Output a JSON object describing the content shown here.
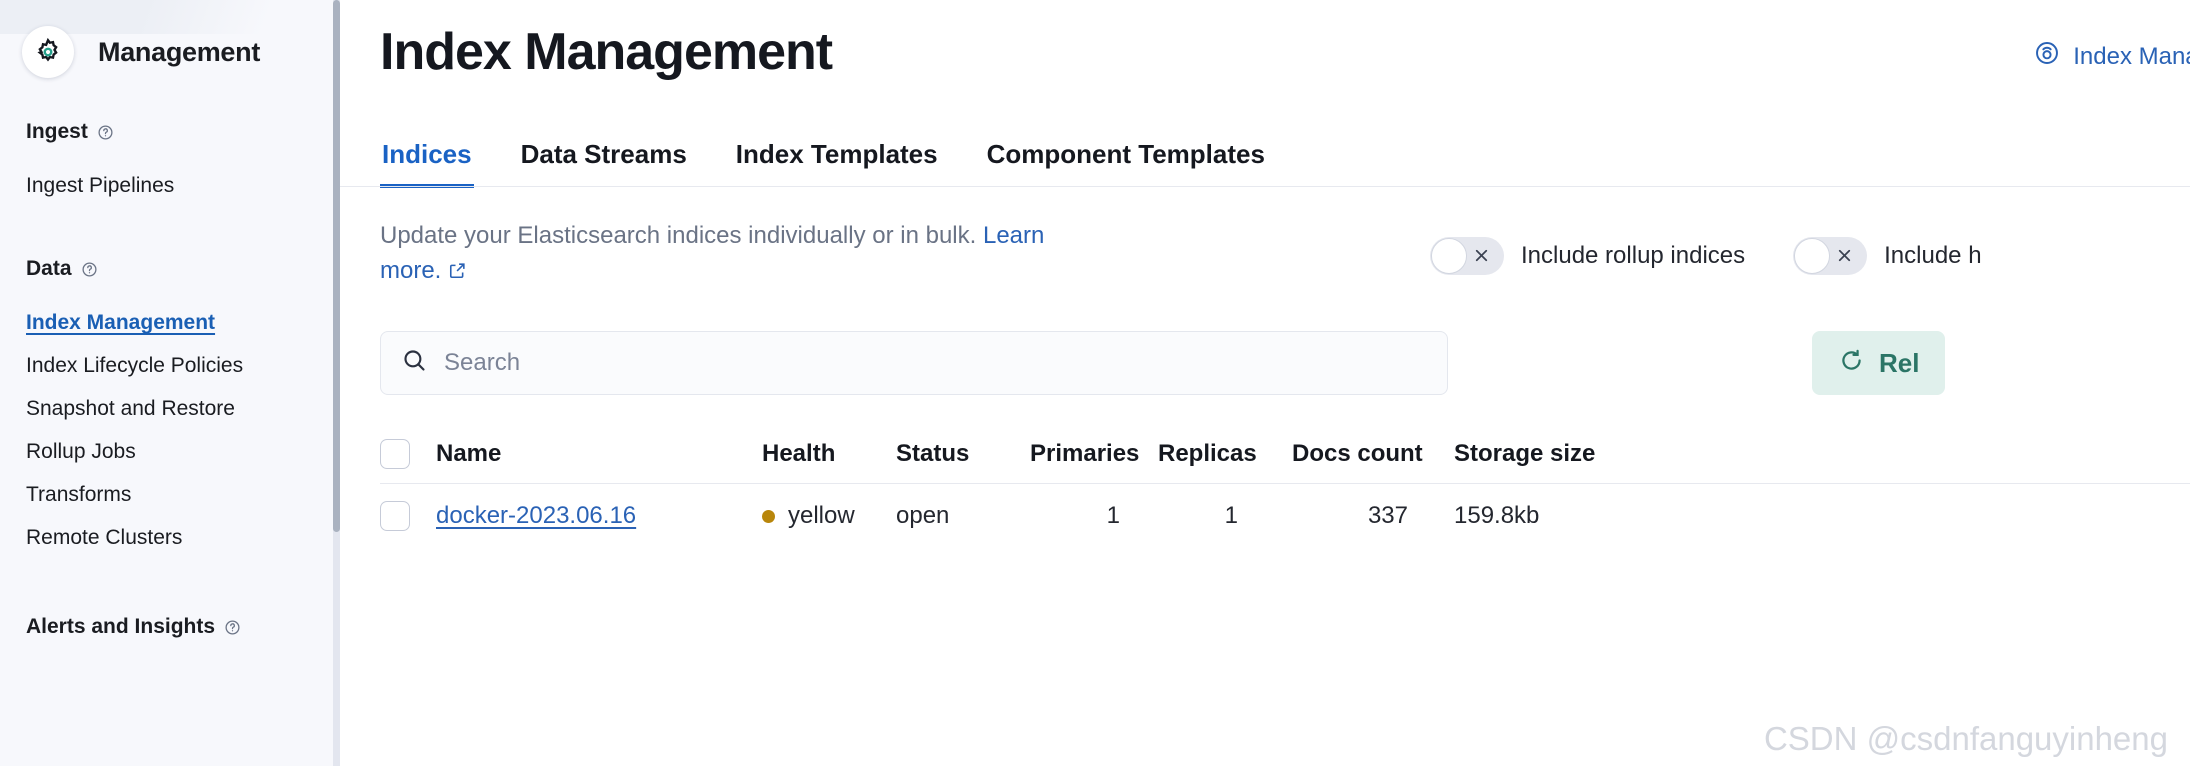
{
  "sidebar": {
    "app_title": "Management",
    "gear_icon": "gear-icon",
    "groups": [
      {
        "heading": "Ingest",
        "help_icon": "help-circle-icon",
        "items": [
          {
            "label": "Ingest Pipelines",
            "active": false
          }
        ]
      },
      {
        "heading": "Data",
        "help_icon": "help-circle-icon",
        "items": [
          {
            "label": "Index Management",
            "active": true
          },
          {
            "label": "Index Lifecycle Policies",
            "active": false
          },
          {
            "label": "Snapshot and Restore",
            "active": false
          },
          {
            "label": "Rollup Jobs",
            "active": false
          },
          {
            "label": "Transforms",
            "active": false
          },
          {
            "label": "Remote Clusters",
            "active": false
          }
        ]
      },
      {
        "heading": "Alerts and Insights",
        "help_icon": "help-circle-icon",
        "items": []
      }
    ]
  },
  "header": {
    "page_title": "Index Management",
    "doc_link_label": "Index Manag",
    "doc_link_icon": "help-circle-icon"
  },
  "tabs": [
    {
      "label": "Indices",
      "active": true
    },
    {
      "label": "Data Streams",
      "active": false
    },
    {
      "label": "Index Templates",
      "active": false
    },
    {
      "label": "Component Templates",
      "active": false
    }
  ],
  "description": {
    "text_before": "Update your Elasticsearch indices individually or in bulk. ",
    "link_text": "Learn more.",
    "external_icon": "external-link-icon"
  },
  "toggles": [
    {
      "label": "Include rollup indices",
      "state": "off",
      "icon": "cross-icon"
    },
    {
      "label": "Include h",
      "state": "off",
      "icon": "cross-icon"
    }
  ],
  "search": {
    "placeholder": "Search",
    "value": "",
    "icon": "search-icon"
  },
  "reload_button": {
    "label": "Rel",
    "icon": "refresh-icon"
  },
  "table": {
    "columns": [
      "Name",
      "Health",
      "Status",
      "Primaries",
      "Replicas",
      "Docs count",
      "Storage size"
    ],
    "rows": [
      {
        "name": "docker-2023.06.16",
        "health": "yellow",
        "health_color": "#b8860b",
        "status": "open",
        "primaries": "1",
        "replicas": "1",
        "docs_count": "337",
        "storage_size": "159.8kb"
      }
    ]
  },
  "watermark": "CSDN @csdnfanguyinheng",
  "colors": {
    "accent_blue": "#1a62c4",
    "link_blue": "#2a62b5",
    "reload_teal": "#2b7566",
    "reload_bg": "#e0f0ec",
    "sidebar_bg": "#f7f8fc"
  }
}
